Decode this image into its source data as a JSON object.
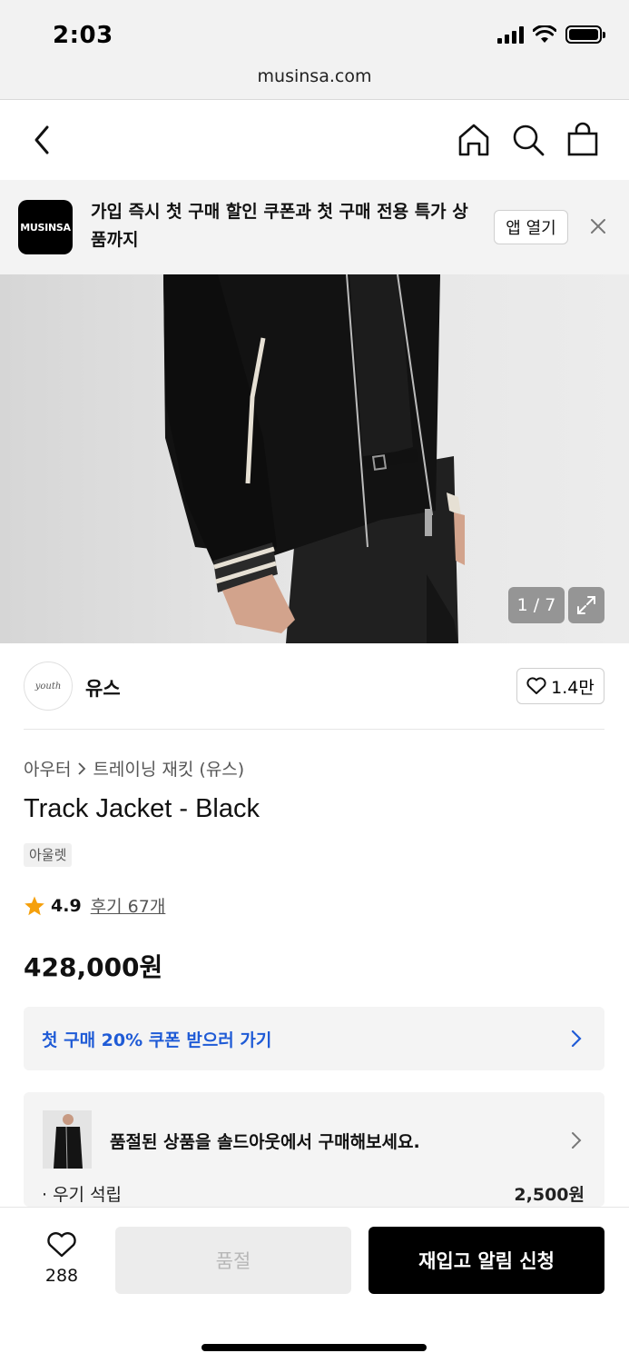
{
  "status_bar": {
    "time": "2:03"
  },
  "browser": {
    "url": "musinsa.com"
  },
  "banner": {
    "logo_text": "MUSINSA",
    "message": "가입 즉시 첫 구매 할인 쿠폰과 첫 구매 전용 특가 상품까지",
    "open_app_label": "앱 열기"
  },
  "gallery": {
    "counter": "1 / 7"
  },
  "brand": {
    "logo_text": "youth",
    "name": "유스",
    "likes": "1.4만"
  },
  "product": {
    "breadcrumb": [
      "아우터",
      "트레이닝 재킷 (유스)"
    ],
    "title": "Track Jacket - Black",
    "tag": "아울렛",
    "rating": "4.9",
    "reviews": "후기 67개",
    "price": "428,000원"
  },
  "coupon": {
    "label": "첫 구매 20% 쿠폰 받으러 가기"
  },
  "soldout_card": {
    "message": "품절된 상품을 솔드아웃에서 구매해보세요.",
    "sub_left": "· 우기 석립",
    "sub_right": "2,500원"
  },
  "bottom_bar": {
    "wish_count": "288",
    "soldout_label": "품절",
    "restock_label": "재입고 알림 신청"
  },
  "colors": {
    "accent_blue": "#1f5bd6",
    "star": "#f5a00c",
    "primary_button": "#000000"
  }
}
